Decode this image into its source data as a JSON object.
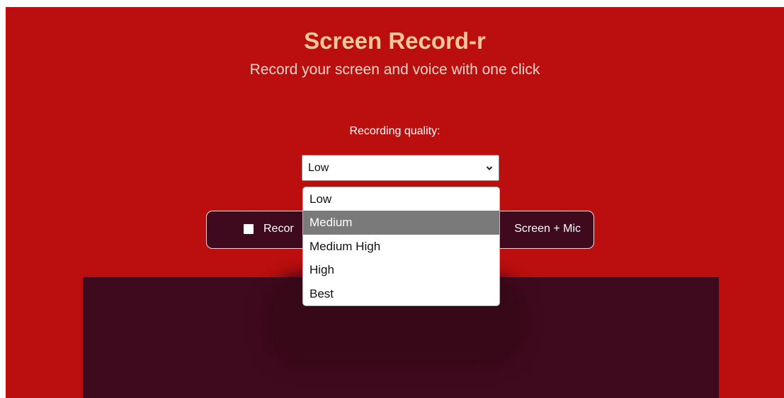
{
  "header": {
    "title": "Screen Record-r",
    "subtitle": "Record your screen and voice with one click"
  },
  "quality": {
    "label": "Recording quality:",
    "selected": "Low",
    "highlighted": "Medium",
    "options": [
      "Low",
      "Medium",
      "Medium High",
      "High",
      "Best"
    ]
  },
  "record": {
    "label_left": "Recor",
    "label_right": "Screen + Mic",
    "checkbox_checked": false
  },
  "colors": {
    "background": "#bb0e0e",
    "title": "#f6c79a",
    "panel": "#3f0a1e",
    "highlight": "#7a7a7a"
  },
  "icons": {
    "select_chevron": "chevron-down-icon"
  }
}
